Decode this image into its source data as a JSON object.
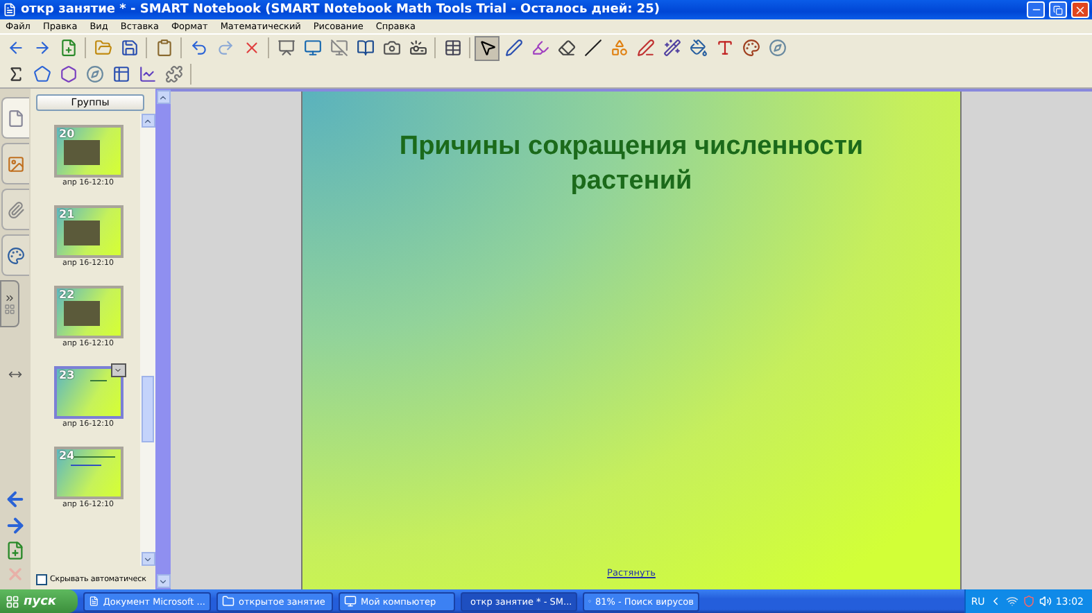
{
  "window": {
    "title": "откр занятие * - SMART Notebook (SMART Notebook Math Tools Trial - Осталось дней: 25)"
  },
  "menu": [
    "Файл",
    "Правка",
    "Вид",
    "Вставка",
    "Формат",
    "Математический",
    "Рисование",
    "Справка"
  ],
  "toolbar_tools": [
    {
      "selected": false
    },
    {
      "selected": false
    },
    {
      "selected": false
    },
    {
      "selected": false
    },
    {
      "selected": false
    },
    {
      "selected": false
    },
    {
      "selected": false
    },
    {
      "selected": false
    },
    {
      "selected": false
    },
    {
      "selected": false
    },
    {
      "selected": false
    },
    {
      "selected": false
    },
    {
      "selected": false
    },
    {
      "selected": false
    },
    {
      "selected": false
    },
    {
      "selected": false
    },
    {
      "selected": true
    },
    {
      "selected": false
    },
    {
      "selected": false
    },
    {
      "selected": false
    },
    {
      "selected": false
    },
    {
      "selected": false
    },
    {
      "selected": false
    },
    {
      "selected": false
    },
    {
      "selected": false
    },
    {
      "selected": false
    },
    {
      "selected": false
    },
    {
      "selected": false
    }
  ],
  "side_tabs": [
    {
      "selected": true
    },
    {
      "selected": false
    },
    {
      "selected": false
    },
    {
      "selected": false
    }
  ],
  "sorter": {
    "groups_button": "Группы",
    "pages": [
      {
        "number": "20",
        "caption": "апр 16-12:10",
        "kind": "photo",
        "selected": false
      },
      {
        "number": "21",
        "caption": "апр 16-12:10",
        "kind": "photo",
        "selected": false
      },
      {
        "number": "22",
        "caption": "апр 16-12:10",
        "kind": "photo",
        "selected": false
      },
      {
        "number": "23",
        "caption": "апр 16-12:10",
        "kind": "plain",
        "selected": true
      },
      {
        "number": "24",
        "caption": "апр 16-12:10",
        "kind": "lines",
        "selected": false
      }
    ],
    "autohide": {
      "label": "Скрывать автоматическ",
      "checked": false
    }
  },
  "slide": {
    "title": "Причины сокращения численности растений",
    "link": "Растянуть"
  },
  "taskbar": {
    "start": "пуск",
    "items": [
      {
        "label": "Документ Microsoft ...",
        "selected": false,
        "kind": "doc"
      },
      {
        "label": "открытое занятие",
        "selected": false,
        "kind": "folder"
      },
      {
        "label": "Мой компьютер",
        "selected": false,
        "kind": "computer"
      },
      {
        "label": "откр занятие * - SM...",
        "selected": true,
        "kind": "notebook"
      },
      {
        "label": "81% - Поиск вирусов",
        "selected": false,
        "kind": "antivirus"
      }
    ],
    "language": "RU",
    "clock": "13:02"
  }
}
